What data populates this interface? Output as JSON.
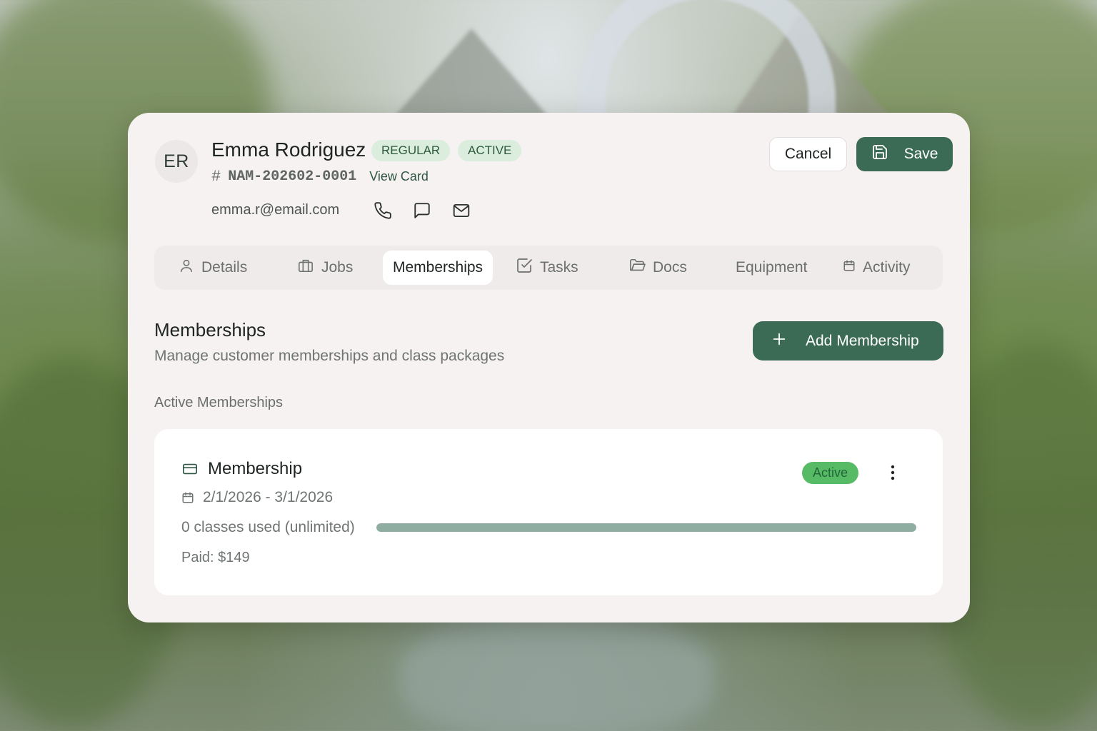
{
  "colors": {
    "accent": "#3b6b55",
    "badge_bg": "#dbeedd",
    "status_active": "#57bb66",
    "progress_fill": "#8fada0"
  },
  "customer": {
    "initials": "ER",
    "name": "Emma Rodriguez",
    "badges": [
      "REGULAR",
      "ACTIVE"
    ],
    "id_prefix": "#",
    "id": "NAM-202602-0001",
    "view_card": "View Card",
    "email": "emma.r@email.com",
    "contact_icons": [
      "phone-icon",
      "message-icon",
      "mail-icon"
    ]
  },
  "header_actions": {
    "cancel": "Cancel",
    "save": "Save",
    "save_icon": "floppy-disk-icon"
  },
  "tabs": [
    {
      "label": "Details",
      "icon": "user-icon"
    },
    {
      "label": "Jobs",
      "icon": "briefcase-icon"
    },
    {
      "label": "Memberships",
      "icon": "",
      "selected": true
    },
    {
      "label": "Tasks",
      "icon": "checkbox-icon"
    },
    {
      "label": "Docs",
      "icon": "folder-icon"
    },
    {
      "label": "Equipment",
      "icon": ""
    },
    {
      "label": "Activity",
      "icon": "calendar-icon"
    }
  ],
  "section": {
    "title": "Memberships",
    "subtitle": "Manage customer memberships and class packages",
    "add_button": "Add Membership",
    "subhead": "Active Memberships"
  },
  "membership": {
    "title": "Membership",
    "icon": "credit-card-icon",
    "dates": "2/1/2026 - 3/1/2026",
    "usage": "0 classes used (unlimited)",
    "usage_fraction": 1.0,
    "paid": "Paid: $149",
    "status": "Active"
  }
}
